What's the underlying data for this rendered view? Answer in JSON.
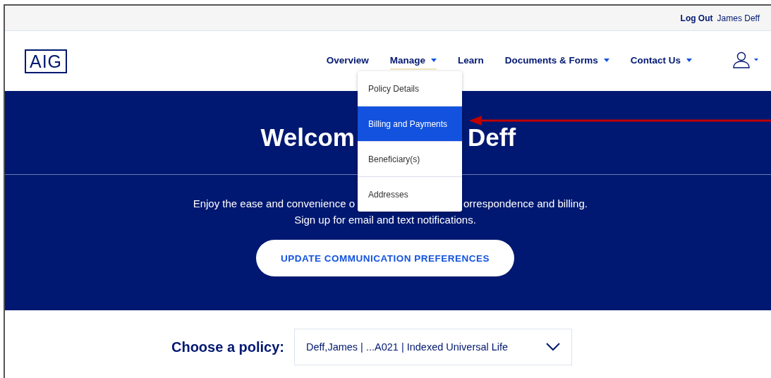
{
  "top_bar": {
    "logout": "Log Out",
    "user_name": "James Deff"
  },
  "logo": "AIG",
  "nav": [
    {
      "label": "Overview",
      "has_caret": false,
      "open": false
    },
    {
      "label": "Manage",
      "has_caret": true,
      "open": true
    },
    {
      "label": "Learn",
      "has_caret": false,
      "open": false
    },
    {
      "label": "Documents & Forms",
      "has_caret": true,
      "open": false
    },
    {
      "label": "Contact Us",
      "has_caret": true,
      "open": false
    }
  ],
  "manage_menu": [
    {
      "label": "Policy Details",
      "selected": false
    },
    {
      "label": "Billing and Payments",
      "selected": true
    },
    {
      "label": "Beneficiary(s)",
      "selected": false
    },
    {
      "label": "Addresses",
      "selected": false
    }
  ],
  "hero": {
    "heading_left": "Welcom",
    "heading_right": "Deff",
    "intro_left": "Enjoy the ease and convenience o",
    "intro_right": "orrespondence and billing.",
    "intro_line2": "Sign up for email and text notifications.",
    "button": "UPDATE COMMUNICATION PREFERENCES"
  },
  "policy": {
    "label": "Choose a policy:",
    "value": "Deff,James | ...A021 | Indexed Universal Life"
  }
}
